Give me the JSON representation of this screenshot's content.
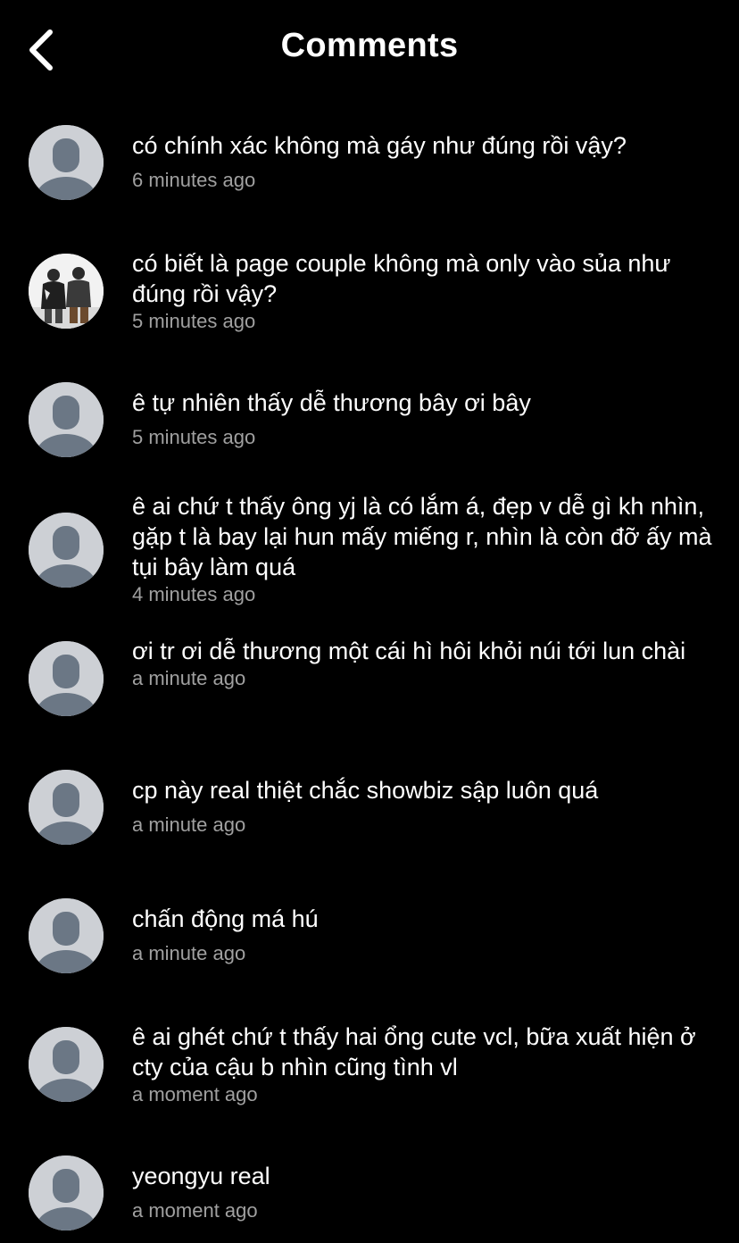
{
  "header": {
    "title": "Comments",
    "back_icon": "chevron-left-icon"
  },
  "comments": [
    {
      "text": "có chính xác không mà gáy như đúng rồi vậy?",
      "time": "6 minutes ago",
      "avatar": "default"
    },
    {
      "text": "có biết là page couple không mà only vào sủa như đúng rồi vậy?",
      "time": "5 minutes ago",
      "avatar": "photo"
    },
    {
      "text": "ê tự nhiên thấy dễ thương bây ơi bây",
      "time": "5 minutes ago",
      "avatar": "default"
    },
    {
      "text": "ê ai chứ t thấy ông yj là có lắm á, đẹp v dễ gì kh nhìn, gặp t là bay lại hun mấy miếng r, nhìn là còn đỡ ấy mà tụi bây làm quá",
      "time": "4 minutes ago",
      "avatar": "default"
    },
    {
      "text": "ơi tr ơi dễ thương một cái hì hôi khỏi núi tới lun chài",
      "time": "a minute ago",
      "avatar": "default"
    },
    {
      "text": "cp này real thiệt chắc showbiz sập luôn quá",
      "time": "a minute ago",
      "avatar": "default"
    },
    {
      "text": "chấn động má hú",
      "time": "a minute ago",
      "avatar": "default"
    },
    {
      "text": "ê ai ghét chứ t thấy hai ổng cute vcl, bữa xuất hiện ở cty của cậu b nhìn cũng tình vl",
      "time": "a moment ago",
      "avatar": "default"
    },
    {
      "text": "yeongyu real",
      "time": "a moment ago",
      "avatar": "default"
    }
  ],
  "colors": {
    "background": "#000000",
    "text": "#ffffff",
    "time": "#a0a0a0",
    "avatar_bg": "#cdd0d5",
    "avatar_figure": "#6b7785"
  }
}
